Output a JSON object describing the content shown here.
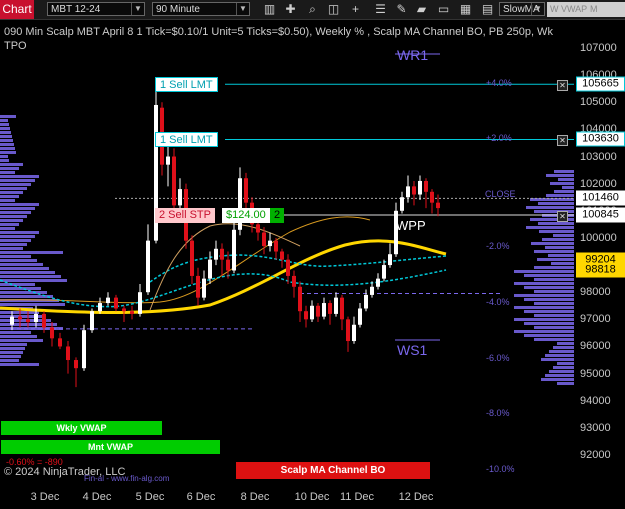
{
  "toolbar": {
    "title": "Chart",
    "instrument": "MBT 12-24",
    "interval": "90 Minute",
    "indicator_select": "SlowMA",
    "btn_wvwap": "W VWAP",
    "btn_mvwap": "M VWAP"
  },
  "header": {
    "line1": "090 Min Scalp MBT April 8 1 Tick=$0.10/1 Unit=5 Ticks=$0.50), Weekly % , Scalp MA Channel BO, PB 250p, Wk",
    "line2": "TPO"
  },
  "levels": {
    "wr1": "WR1",
    "wpp": "WPP",
    "ws1": "WS1",
    "close": "CLOSE"
  },
  "percent_labels": [
    {
      "text": "+4.0%",
      "price": 105665
    },
    {
      "text": "+2.0%",
      "price": 103630
    },
    {
      "text": "-2.0%",
      "price": 99650
    },
    {
      "text": "-4.0%",
      "price": 97600
    },
    {
      "text": "-6.0%",
      "price": 95550
    },
    {
      "text": "-8.0%",
      "price": 93500
    },
    {
      "text": "-10.0%",
      "price": 91450
    }
  ],
  "orders": {
    "sell_lmt_1": "1 Sell LMT",
    "sell_lmt_2": "1 Sell LMT",
    "sell_stp": "2 Sell STP",
    "pnl": "$124.00",
    "qty": "2"
  },
  "price_axis": {
    "ticks": [
      107000,
      106000,
      105000,
      104000,
      103000,
      102000,
      101000,
      100000,
      99000,
      98000,
      97000,
      96000,
      95000,
      94000,
      93000,
      92000
    ],
    "tick_labels": [
      "107000",
      "106000",
      "105000",
      "104000",
      "103000",
      "102000",
      "101000",
      "100000",
      "99000",
      "98000",
      "97000",
      "96000",
      "95000",
      "94000",
      "93000",
      "92000"
    ],
    "markers": [
      {
        "label": "105665",
        "price": 105665,
        "bg": "#ffffff",
        "fg": "#000000",
        "border": "#00c8d8"
      },
      {
        "label": "103630",
        "price": 103630,
        "bg": "#ffffff",
        "fg": "#000000",
        "border": "#00c8d8"
      },
      {
        "label": "101460",
        "price": 101460,
        "bg": "#ffffff",
        "fg": "#000000",
        "border": "#ffffff"
      },
      {
        "label": "100845",
        "price": 100845,
        "bg": "#ffffff",
        "fg": "#000000",
        "border": "#ffffff"
      },
      {
        "label": "99204",
        "price": 99204,
        "bg": "#ffd700",
        "fg": "#000000",
        "border": "#ffd700"
      },
      {
        "label": "98818",
        "price": 98818,
        "bg": "#ffd700",
        "fg": "#000000",
        "border": "#ffd700"
      }
    ]
  },
  "time_axis": [
    "3 Dec",
    "4 Dec",
    "5 Dec",
    "6 Dec",
    "8 Dec",
    "10 Dec",
    "11 Dec",
    "12 Dec"
  ],
  "bottom_labels": {
    "wkly_vwap": "Wkly VWAP",
    "mnt_vwap": "Mnt VWAP",
    "pct_change": "-0.60% = -890",
    "copyright": "© 2024 NinjaTrader, LLC",
    "source": "Fin-al - www.fin-alg.com",
    "scalp_bo": "Scalp MA Channel BO"
  },
  "colors": {
    "bull": "#ffffff",
    "bear": "#e0101a",
    "accent": "#00c8d8",
    "profile": "#7b68ee",
    "wvwap": "#00cc00",
    "bo_band": "#dd1111"
  }
}
